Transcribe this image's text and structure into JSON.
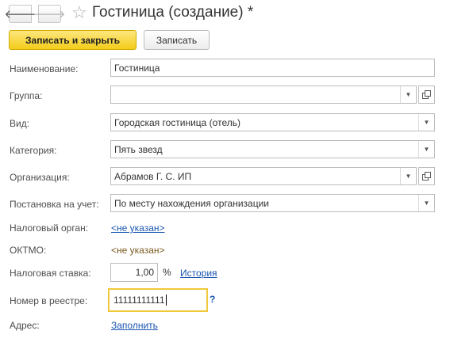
{
  "window": {
    "title": "Гостиница (создание) *"
  },
  "toolbar": {
    "save_close_label": "Записать и закрыть",
    "save_label": "Записать"
  },
  "nav": {
    "back_glyph": "🡐",
    "forward_glyph": "🡒",
    "favorite_glyph": "☆"
  },
  "form": {
    "name": {
      "label": "Наименование:",
      "value": "Гостиница"
    },
    "group": {
      "label": "Группа:",
      "value": ""
    },
    "kind": {
      "label": "Вид:",
      "value": "Городская гостиница (отель)"
    },
    "category": {
      "label": "Категория:",
      "value": "Пять звезд"
    },
    "organization": {
      "label": "Организация:",
      "value": "Абрамов Г. С. ИП"
    },
    "registration": {
      "label": "Постановка на учет:",
      "value": "По месту нахождения организации"
    },
    "tax_office": {
      "label": "Налоговый орган:",
      "value": "<не указан>"
    },
    "oktmo": {
      "label": "ОКТМО:",
      "value": "<не указан>"
    },
    "tax_rate": {
      "label": "Налоговая ставка:",
      "value": "1,00",
      "unit": "%",
      "history_link": "История"
    },
    "registry_number": {
      "label": "Номер в реестре:",
      "value": "11111111111",
      "help": "?"
    },
    "address": {
      "label": "Адрес:",
      "link": "Заполнить"
    }
  },
  "icons": {
    "dropdown": "chevron-down-icon",
    "open": "open-form-icon",
    "favorite": "star-icon"
  }
}
